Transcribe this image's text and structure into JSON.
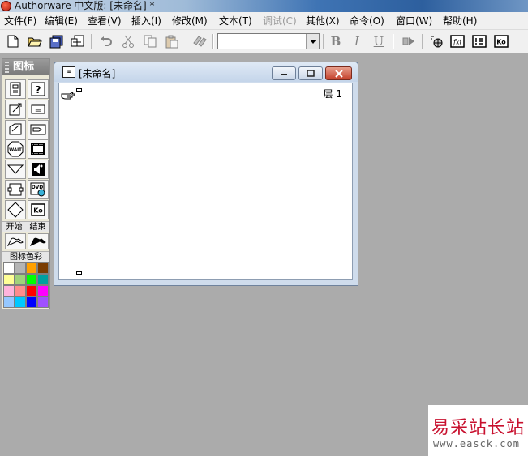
{
  "window": {
    "title": "Authorware 中文版: [未命名] *"
  },
  "menu": [
    {
      "label": "文件(F)",
      "enabled": true
    },
    {
      "label": "编辑(E)",
      "enabled": true
    },
    {
      "label": "查看(V)",
      "enabled": true
    },
    {
      "label": "插入(I)",
      "enabled": true
    },
    {
      "label": "修改(M)",
      "enabled": true
    },
    {
      "label": "文本(T)",
      "enabled": true
    },
    {
      "label": "调试(C)",
      "enabled": false
    },
    {
      "label": "其他(X)",
      "enabled": true
    },
    {
      "label": "命令(O)",
      "enabled": true
    },
    {
      "label": "窗口(W)",
      "enabled": true
    },
    {
      "label": "帮助(H)",
      "enabled": true
    }
  ],
  "toolbar": {
    "font_value": "",
    "bold_glyph": "B",
    "italic_glyph": "I",
    "underline_glyph": "U",
    "run_button_label": "Ko",
    "icons": [
      "new-file-icon",
      "open-folder-icon",
      "save-all-icon",
      "import-icon",
      "undo-icon",
      "cut-icon",
      "copy-icon",
      "paste-icon",
      "find-icon",
      "bold-icon",
      "italic-icon",
      "underline-icon",
      "run-icon",
      "control-panel-icon",
      "functions-icon",
      "variables-icon",
      "knowledge-objects-icon"
    ]
  },
  "palette": {
    "title": "图标",
    "icons": [
      {
        "name": "display-icon",
        "label": ""
      },
      {
        "name": "interaction-icon",
        "label": "?"
      },
      {
        "name": "motion-icon",
        "label": ""
      },
      {
        "name": "calculation-icon",
        "label": "="
      },
      {
        "name": "erase-icon",
        "label": ""
      },
      {
        "name": "navigate-icon",
        "label": ""
      },
      {
        "name": "wait-icon",
        "label": "WAIT"
      },
      {
        "name": "movie-icon",
        "label": ""
      },
      {
        "name": "framework-icon",
        "label": ""
      },
      {
        "name": "sound-icon",
        "label": ""
      },
      {
        "name": "decision-icon",
        "label": ""
      },
      {
        "name": "dvd-icon",
        "label": "DVD"
      },
      {
        "name": "map-icon",
        "label": ""
      },
      {
        "name": "knowledge-object-icon",
        "label": "Ko"
      }
    ],
    "start_label": "开始",
    "end_label": "结束",
    "color_label": "图标色彩",
    "colors": [
      "#ffffff",
      "#b4b4b4",
      "#ffa000",
      "#7a3c00",
      "#ffff96",
      "#a0d27a",
      "#00ff00",
      "#00a0a0",
      "#ffb4dc",
      "#ff8c8c",
      "#ff0000",
      "#ff00ff",
      "#96c8ff",
      "#00c8ff",
      "#0000ff",
      "#a050ff"
    ]
  },
  "flow_window": {
    "title": "[未命名]",
    "layer_label": "层 1"
  },
  "watermark": {
    "line1": "易采站长站",
    "line2": "www.easck.com"
  }
}
